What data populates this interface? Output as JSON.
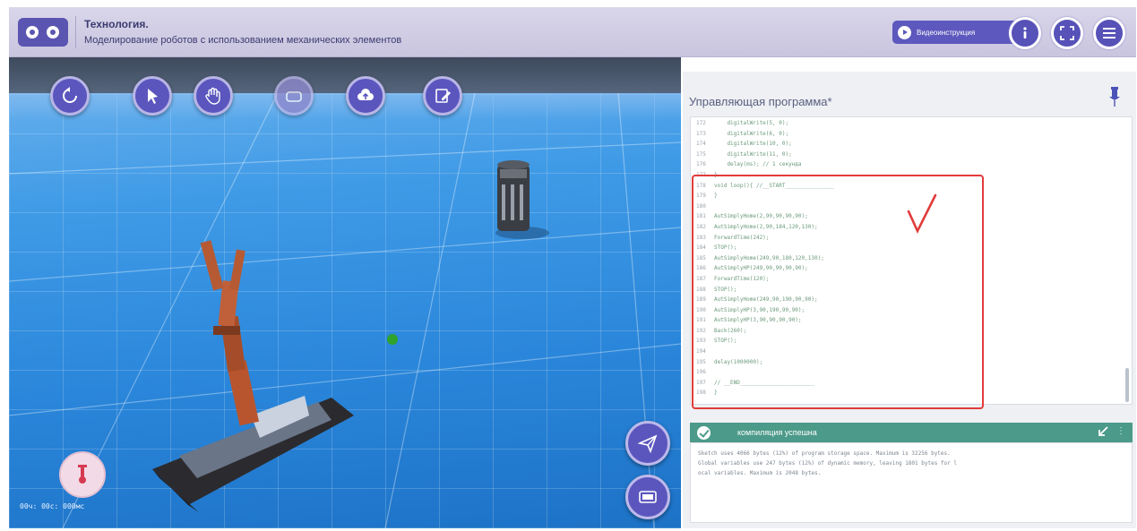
{
  "header": {
    "title": "Технология.",
    "subtitle": "Моделирование роботов с использованием механических элементов",
    "video_button_label": "Видеоинструкция"
  },
  "scene": {
    "toolbar_icons": [
      "reset-icon",
      "cursor-icon",
      "hand-icon",
      "camera-icon",
      "cloud-upload-icon",
      "edit-icon"
    ],
    "coordinates_text": "00ч: 00с: 000мс"
  },
  "panel": {
    "title": "Управляющая программа*",
    "code_lines": [
      {
        "num": "172",
        "text": "    digitalWrite(5, 0);"
      },
      {
        "num": "173",
        "text": "    digitalWrite(6, 0);"
      },
      {
        "num": "174",
        "text": "    digitalWrite(10, 0);"
      },
      {
        "num": "175",
        "text": "    digitalWrite(11, 0);"
      },
      {
        "num": "176",
        "text": "    delay(ms); // 1 секунда"
      },
      {
        "num": "177",
        "text": "}"
      },
      {
        "num": "178",
        "text": "void loop(){ //__START_______________"
      },
      {
        "num": "179",
        "text": "}"
      },
      {
        "num": "180",
        "text": ""
      },
      {
        "num": "181",
        "text": "AutSimplyHome(2,90,90,90,90);"
      },
      {
        "num": "182",
        "text": "AutSimplyHome(2,90,184,120,130);"
      },
      {
        "num": "183",
        "text": "ForwardTime(242);"
      },
      {
        "num": "184",
        "text": "STOP();"
      },
      {
        "num": "185",
        "text": "AutSimplyHome(249,90,180,120,130);"
      },
      {
        "num": "186",
        "text": "AutSimplyHP(249,90,90,90,90);"
      },
      {
        "num": "187",
        "text": "ForwardTime(120);"
      },
      {
        "num": "188",
        "text": "STOP();"
      },
      {
        "num": "189",
        "text": "AutSimplyHome(249,90,190,90,90);"
      },
      {
        "num": "190",
        "text": "AutSimplyHP(3,90,190,90,90);"
      },
      {
        "num": "191",
        "text": "AutSimplyHP(3,90,90,90,90);"
      },
      {
        "num": "192",
        "text": "Back(260);"
      },
      {
        "num": "193",
        "text": "STOP();"
      },
      {
        "num": "194",
        "text": ""
      },
      {
        "num": "195",
        "text": "delay(1000000);"
      },
      {
        "num": "196",
        "text": ""
      },
      {
        "num": "197",
        "text": "// __END_______________________"
      },
      {
        "num": "198",
        "text": "}"
      }
    ],
    "status_text": "компиляция успешна",
    "console_text": "Sketch uses 4066 bytes (12%) of program storage space. Maximum is 32256 bytes.\nGlobal variables use 247 bytes (12%) of dynamic memory, leaving 1801 bytes for l\nocal variables. Maximum is 2048 bytes."
  },
  "colors": {
    "header_bg": "#d0cde4",
    "brand_purple": "#5a55b0",
    "status_green": "#4c9a8a",
    "annotation_red": "#e23b3b"
  }
}
